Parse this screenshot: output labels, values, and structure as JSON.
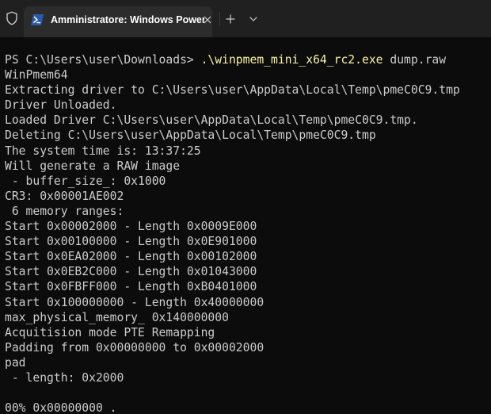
{
  "window": {
    "tab_title": "Amministratore: Windows PowerShell",
    "icons": {
      "shield": "shield-icon",
      "powershell": "powershell-icon",
      "close": "close-icon",
      "new_tab": "plus-icon",
      "dropdown": "chevron-down-icon"
    },
    "colors": {
      "background": "#0c0c0c",
      "titlebar": "#202020",
      "tab": "#2c2c2c",
      "text": "#cccccc",
      "command_highlight": "#f9f1a5",
      "powershell_blue": "#2b5ba8"
    }
  },
  "terminal": {
    "prompt": "PS C:\\Users\\user\\Downloads> ",
    "command": ".\\winpmem_mini_x64_rc2.exe",
    "command_args": " dump.raw",
    "output": [
      "WinPmem64",
      "Extracting driver to C:\\Users\\user\\AppData\\Local\\Temp\\pmeC0C9.tmp",
      "Driver Unloaded.",
      "Loaded Driver C:\\Users\\user\\AppData\\Local\\Temp\\pmeC0C9.tmp.",
      "Deleting C:\\Users\\user\\AppData\\Local\\Temp\\pmeC0C9.tmp",
      "The system time is: 13:37:25",
      "Will generate a RAW image",
      " - buffer_size_: 0x1000",
      "CR3: 0x00001AE002",
      " 6 memory ranges:",
      "Start 0x00002000 - Length 0x0009E000",
      "Start 0x00100000 - Length 0x0E901000",
      "Start 0x0EA02000 - Length 0x00102000",
      "Start 0x0EB2C000 - Length 0x01043000",
      "Start 0x0FBFF000 - Length 0xB0401000",
      "Start 0x100000000 - Length 0x40000000",
      "max_physical_memory_ 0x140000000",
      "Acquitision mode PTE Remapping",
      "Padding from 0x00000000 to 0x00002000",
      "pad",
      " - length: 0x2000",
      "",
      "00% 0x00000000 ."
    ]
  }
}
